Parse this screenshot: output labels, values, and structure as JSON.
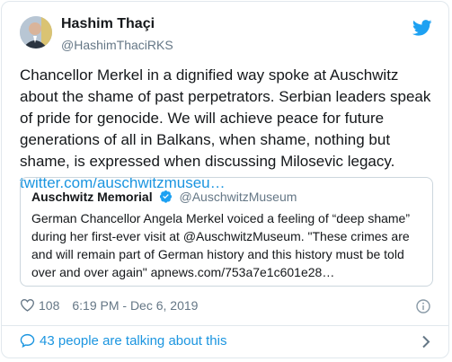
{
  "tweet": {
    "author_name": "Hashim Thaçi",
    "author_handle": "@HashimThaciRKS",
    "text": "Chancellor Merkel in a dignified way spoke at Auschwitz about the shame of past perpetrators. Serbian leaders speak of pride for genocide. We will achieve peace for future generations of all in Balkans, when shame, nothing but shame, is expressed when discussing Milosevic legacy. ",
    "link_text": "twitter.com/auschwitzmuseu…",
    "likes": "108",
    "timestamp": "6:19 PM - Dec 6, 2019",
    "icons": {
      "logo": "twitter-bird-icon",
      "like": "heart-icon",
      "info": "info-icon",
      "verified": "verified-icon",
      "reply": "speech-bubble-icon",
      "more": "chevron-right-icon"
    },
    "colors": {
      "link": "#1b95e0",
      "secondary": "#657786",
      "border": "#e1e8ed"
    }
  },
  "quote": {
    "name": "Auschwitz Memorial",
    "handle": "@AuschwitzMuseum",
    "text": "German Chancellor Angela Merkel voiced a feeling of “deep shame” during her first-ever visit at @AuschwitzMuseum. \"These crimes are and will remain part of German history and this history must be told over and over again\" apnews.com/753a7e1c601e28…"
  },
  "footer": {
    "talking_text": "43 people are talking about this"
  }
}
